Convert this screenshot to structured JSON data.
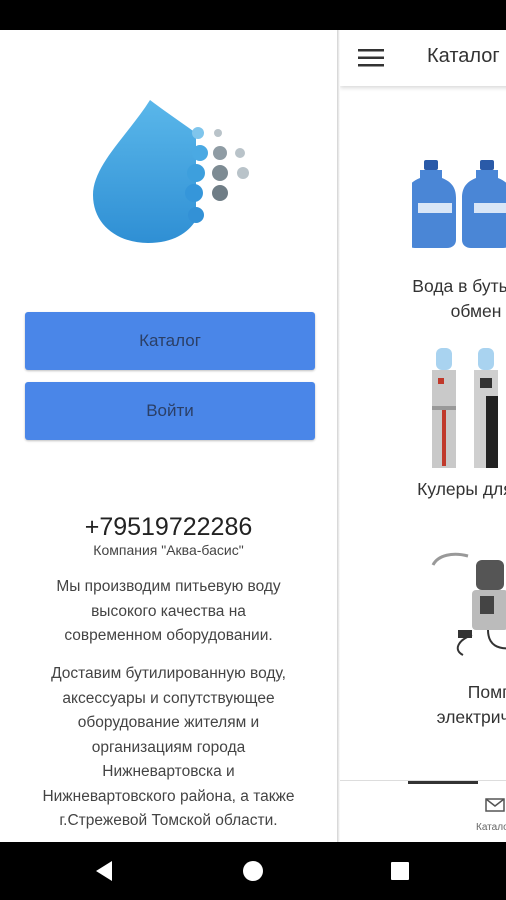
{
  "drawer": {
    "catalog_button": "Каталог",
    "login_button": "Войти",
    "phone": "+79519722286",
    "company": "Компания \"Аква-басис\"",
    "paragraph1": [
      "Мы производим питьевую воду",
      "высокого качества на",
      "современном оборудовании."
    ],
    "paragraph2": [
      "Доставим  бутилированную воду,",
      "аксессуары и сопутствующее",
      "оборудование жителям и",
      "организациям города",
      "Нижневартовска и",
      "Нижневартовского района, а также",
      "г.Стрежевой Томской области."
    ]
  },
  "main": {
    "title": "Каталог",
    "categories": [
      {
        "label_lines": [
          "Вода в бутылях",
          "обмен"
        ],
        "icon": "water-bottles-image"
      },
      {
        "label_lines": [
          "Кулеры для воды"
        ],
        "icon": "water-coolers-image"
      },
      {
        "label_lines": [
          "Помпы",
          "электрические"
        ],
        "icon": "electric-pump-image"
      }
    ],
    "bottom_nav_label": "Каталог"
  },
  "colors": {
    "button": "#4a86e8",
    "button_text": "#2b3f66",
    "logo_blue": "#3fa3e0"
  }
}
